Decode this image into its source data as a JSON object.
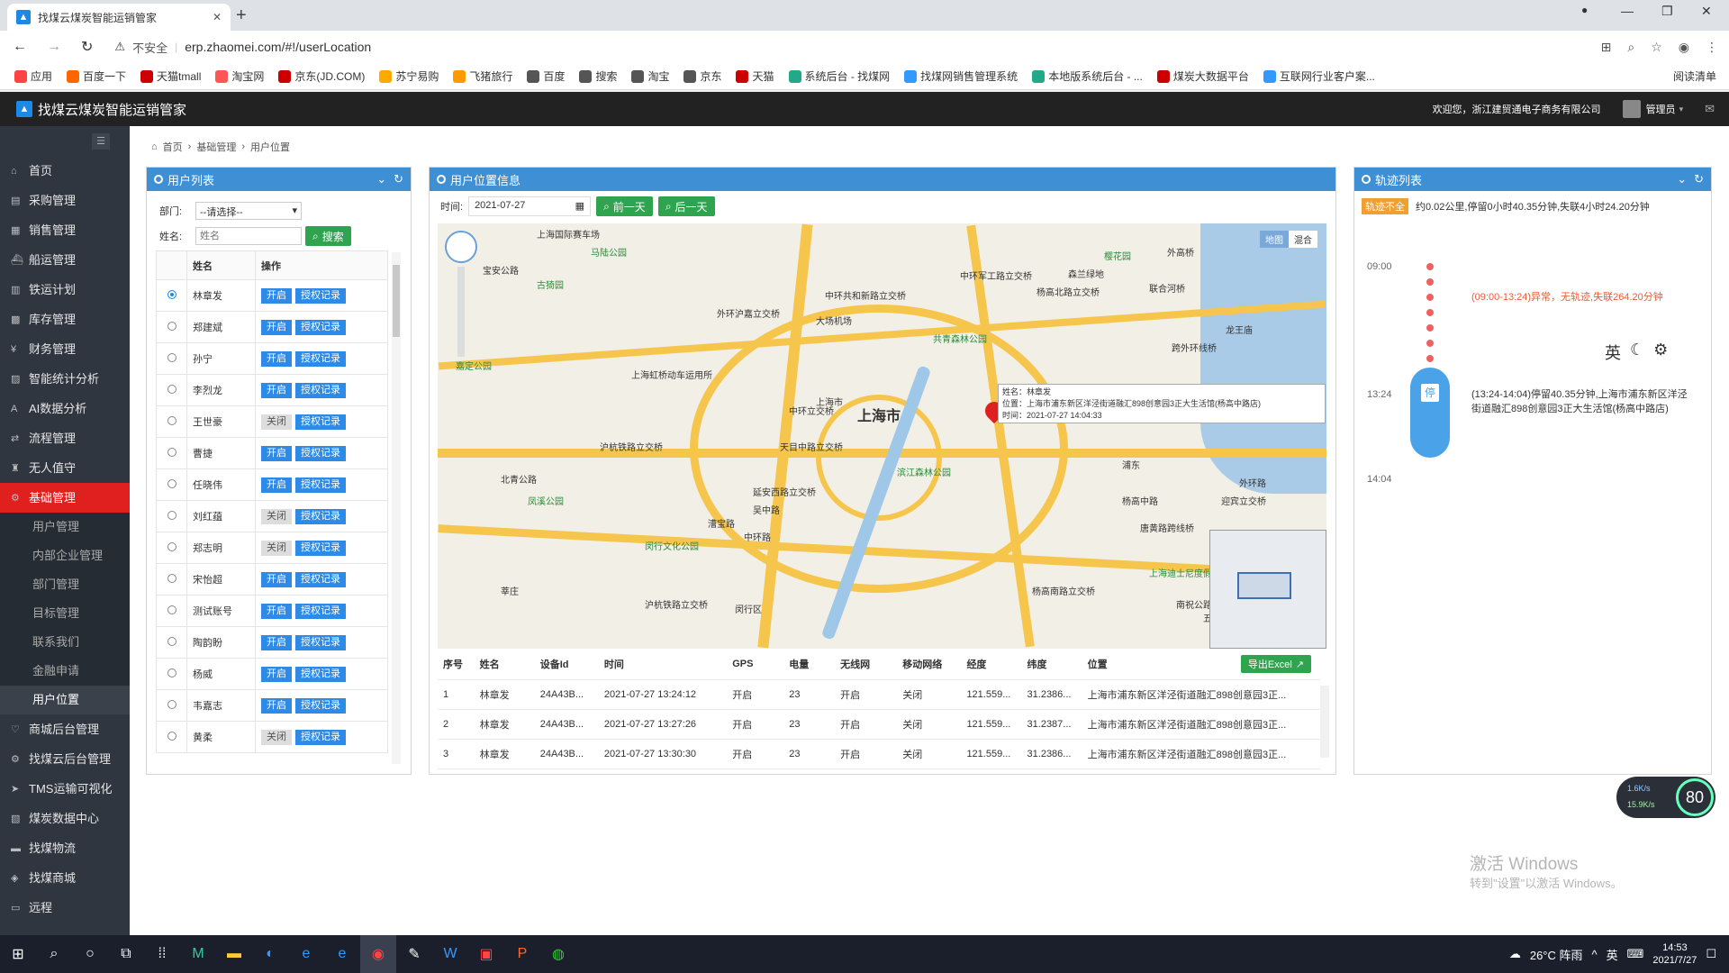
{
  "browser": {
    "tab_title": "找煤云煤炭智能运销管家",
    "security_label": "不安全",
    "url": "erp.zhaomei.com/#!/userLocation",
    "bookmarks": [
      "应用",
      "百度一下",
      "天猫tmall",
      "淘宝网",
      "京东(JD.COM)",
      "苏宁易购",
      "飞猪旅行",
      "百度",
      "搜索",
      "淘宝",
      "京东",
      "天猫",
      "系统后台 - 找煤网",
      "找煤网销售管理系统",
      "本地版系统后台 - ...",
      "煤炭大数据平台",
      "互联网行业客户案..."
    ],
    "reading_list": "阅读清单"
  },
  "app": {
    "title": "找煤云煤炭智能运销管家",
    "welcome": "欢迎您，浙江建贸通电子商务有限公司",
    "user_role": "管理员"
  },
  "sidebar": {
    "items": [
      {
        "label": "首页",
        "icon": "home-icon"
      },
      {
        "label": "采购管理",
        "icon": "cart-icon"
      },
      {
        "label": "销售管理",
        "icon": "doc-icon"
      },
      {
        "label": "船运管理",
        "icon": "ship-icon"
      },
      {
        "label": "铁运计划",
        "icon": "train-icon"
      },
      {
        "label": "库存管理",
        "icon": "warehouse-icon"
      },
      {
        "label": "财务管理",
        "icon": "finance-icon"
      },
      {
        "label": "智能统计分析",
        "icon": "chart-icon"
      },
      {
        "label": "AI数据分析",
        "icon": "ai-icon"
      },
      {
        "label": "流程管理",
        "icon": "flow-icon"
      },
      {
        "label": "无人值守",
        "icon": "unattended-icon"
      },
      {
        "label": "基础管理",
        "icon": "gear-icon"
      }
    ],
    "sub_items": [
      "用户管理",
      "内部企业管理",
      "部门管理",
      "目标管理",
      "联系我们",
      "金融申请",
      "用户位置"
    ],
    "bottom_items": [
      {
        "label": "商城后台管理",
        "icon": "heart-icon"
      },
      {
        "label": "找煤云后台管理",
        "icon": "gear-icon"
      },
      {
        "label": "TMS运输可视化",
        "icon": "send-icon"
      },
      {
        "label": "煤炭数据中心",
        "icon": "database-icon"
      },
      {
        "label": "找煤物流",
        "icon": "truck-icon"
      },
      {
        "label": "找煤商城",
        "icon": "store-icon"
      },
      {
        "label": "远程",
        "icon": "monitor-icon"
      }
    ]
  },
  "breadcrumb": [
    "首页",
    "基础管理",
    "用户位置"
  ],
  "userlist": {
    "title": "用户列表",
    "dept_label": "部门:",
    "dept_value": "--请选择--",
    "name_label": "姓名:",
    "name_placeholder": "姓名",
    "search_btn": "搜索",
    "col_name": "姓名",
    "col_action": "操作",
    "history_btn": "授权记录",
    "rows": [
      {
        "name": "林章发",
        "state": "开启"
      },
      {
        "name": "郑建斌",
        "state": "开启"
      },
      {
        "name": "孙宁",
        "state": "开启"
      },
      {
        "name": "李烈龙",
        "state": "开启"
      },
      {
        "name": "王世豪",
        "state": "关闭"
      },
      {
        "name": "曹捷",
        "state": "开启"
      },
      {
        "name": "任晓伟",
        "state": "开启"
      },
      {
        "name": "刘红蕴",
        "state": "关闭"
      },
      {
        "name": "郑志明",
        "state": "关闭"
      },
      {
        "name": "宋怡超",
        "state": "开启"
      },
      {
        "name": "测试账号",
        "state": "开启"
      },
      {
        "name": "陶韵盼",
        "state": "开启"
      },
      {
        "name": "杨威",
        "state": "开启"
      },
      {
        "name": "韦嘉志",
        "state": "开启"
      },
      {
        "name": "黄柔",
        "state": "关闭"
      }
    ]
  },
  "location": {
    "title": "用户位置信息",
    "time_label": "时间:",
    "date": "2021-07-27",
    "prev_btn": "前一天",
    "next_btn": "后一天",
    "map_types": [
      "地图",
      "混合"
    ],
    "popup": {
      "name": "姓名：林章发",
      "position": "位置：上海市浦东新区洋泾街道融汇898创意园3正大生活馆(杨高中路店)",
      "time": "时间：2021-07-27 14:04:33"
    },
    "city_label": "上海市",
    "export_btn": "导出Excel",
    "columns": [
      "序号",
      "姓名",
      "设备Id",
      "时间",
      "GPS",
      "电量",
      "无线网",
      "移动网络",
      "经度",
      "纬度",
      "位置"
    ],
    "rows": [
      [
        "1",
        "林章发",
        "24A43B...",
        "2021-07-27 13:24:12",
        "开启",
        "23",
        "开启",
        "关闭",
        "121.559...",
        "31.2386...",
        "上海市浦东新区洋泾街道融汇898创意园3正..."
      ],
      [
        "2",
        "林章发",
        "24A43B...",
        "2021-07-27 13:27:26",
        "开启",
        "23",
        "开启",
        "关闭",
        "121.559...",
        "31.2387...",
        "上海市浦东新区洋泾街道融汇898创意园3正..."
      ],
      [
        "3",
        "林章发",
        "24A43B...",
        "2021-07-27 13:30:30",
        "开启",
        "23",
        "开启",
        "关闭",
        "121.559...",
        "31.2386...",
        "上海市浦东新区洋泾街道融汇898创意园3正..."
      ]
    ]
  },
  "track": {
    "title": "轨迹列表",
    "badge": "轨迹不全",
    "summary": "约0.02公里,停留0小时40.35分钟,失联4小时24.20分钟",
    "t1": "09:00",
    "abnormal": "(09:00-13:24)异常，无轨迹,失联264.20分钟",
    "t2": "13:24",
    "stop_label": "停",
    "stop_desc": "(13:24-14:04)停留40.35分钟,上海市浦东新区洋泾街道融汇898创意园3正大生活馆(杨高中路店)",
    "t3": "14:04",
    "ime": "英"
  },
  "overlay": {
    "speed_up": "1.6K/s",
    "speed_down": "15.9K/s",
    "percent": "80",
    "win_activate": "激活 Windows",
    "win_activate_sub": "转到\"设置\"以激活 Windows。"
  },
  "taskbar": {
    "weather": "26°C 阵雨",
    "ime": "英",
    "time": "14:53",
    "date": "2021/7/27"
  },
  "map_labels": [
    "上海国际赛车场",
    "马陆公园",
    "宝安公路",
    "古猗园",
    "中环共和新路立交桥",
    "外环沪嘉立交桥",
    "大场机场",
    "中环军工路立交桥",
    "杨高北路立交桥",
    "联合河桥",
    "森兰绿地",
    "外高桥",
    "樱花园",
    "上海虹桥动车运用所",
    "沪杭铁路立交桥",
    "中环立交桥",
    "上海市",
    "天目中路立交桥",
    "延安西路立交桥",
    "中环路",
    "北青公路",
    "凤溪公园",
    "吴中路",
    "漕宝路",
    "闵行文化公园",
    "沪杭铁路立交桥",
    "杨高南路立交桥",
    "杨高中路",
    "外环路",
    "唐黄路跨线桥",
    "迎宾立交桥",
    "江镇市民广场",
    "上海迪士尼度假区",
    "南祝公路立交桥",
    "五灶港桥",
    "莘庄",
    "闵行区",
    "浦东",
    "滨江森林公园",
    "共青森林公园",
    "龙王庙",
    "跨外环线桥",
    "嘉定公园"
  ],
  "colors": {
    "accent_blue": "#3f8fd5",
    "danger_red": "#e0201f",
    "green": "#2ea44f",
    "sidebar": "#2f3640"
  }
}
